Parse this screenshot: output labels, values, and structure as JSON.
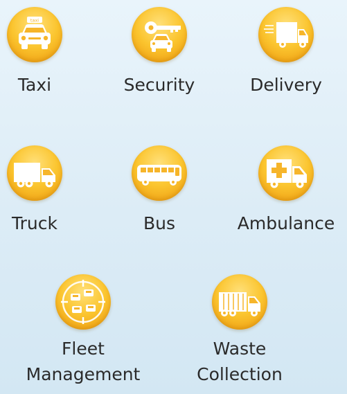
{
  "services": [
    {
      "id": "taxi",
      "label": "Taxi",
      "icon": "taxi-icon"
    },
    {
      "id": "security",
      "label": "Security",
      "icon": "security-key-car-icon"
    },
    {
      "id": "delivery",
      "label": "Delivery",
      "icon": "delivery-van-icon"
    },
    {
      "id": "truck",
      "label": "Truck",
      "icon": "truck-icon"
    },
    {
      "id": "bus",
      "label": "Bus",
      "icon": "bus-icon"
    },
    {
      "id": "ambulance",
      "label": "Ambulance",
      "icon": "ambulance-icon"
    },
    {
      "id": "fleet",
      "label_lines": [
        "Fleet",
        "Management"
      ],
      "icon": "fleet-target-icon"
    },
    {
      "id": "waste",
      "label_lines": [
        "Waste",
        "Collection"
      ],
      "icon": "garbage-truck-icon"
    }
  ],
  "colors": {
    "circle_light": "#ffe07a",
    "circle_mid": "#fbc52f",
    "circle_dark": "#e59a14",
    "glyph": "#ffffff",
    "label": "#2a2a2a",
    "background_top": "#e9f4fb",
    "background_bottom": "#d3e7f3"
  }
}
